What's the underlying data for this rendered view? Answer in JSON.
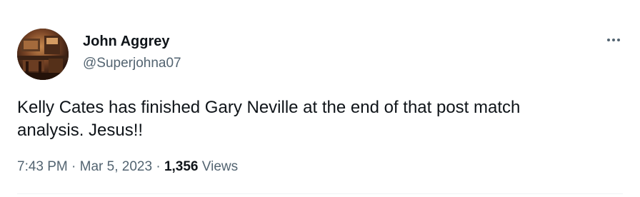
{
  "tweet": {
    "author_name": "John Aggrey",
    "author_handle": "@Superjohna07",
    "text": "Kelly Cates has finished Gary Neville at the end of that post match\nanalysis. Jesus!!",
    "time": "7:43 PM",
    "separator": "·",
    "date": "Mar 5, 2023",
    "views_count": "1,356",
    "views_label": "Views"
  },
  "icons": {
    "avatar": "avatar-photo",
    "more": "more-options-icon"
  },
  "colors": {
    "text_primary": "#0f1419",
    "text_secondary": "#536471",
    "divider": "#eff3f4"
  }
}
